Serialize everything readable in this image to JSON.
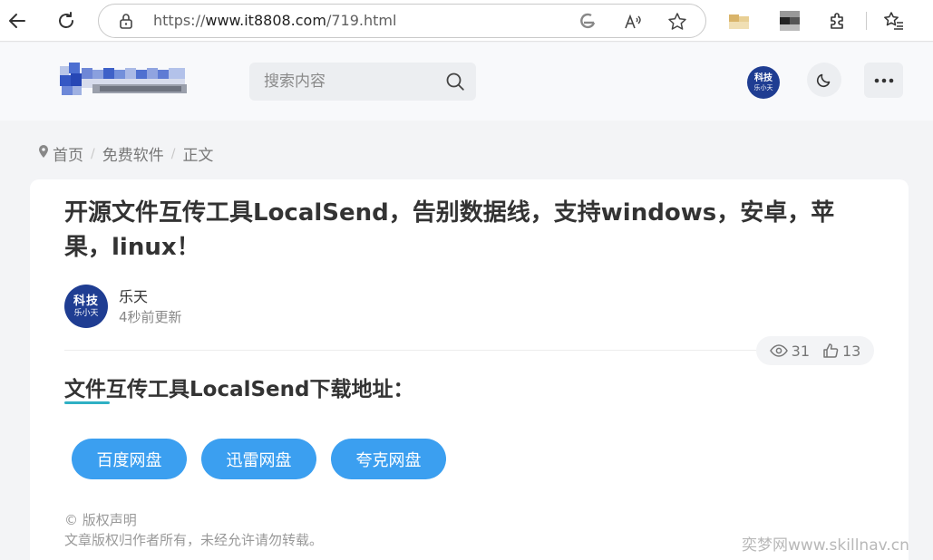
{
  "browser": {
    "url_prefix": "https://",
    "url_host": "www.it8808.com",
    "url_path": "/719.html"
  },
  "header": {
    "search_placeholder": "搜索内容",
    "avatar_line1": "科技",
    "avatar_line2": "乐小天"
  },
  "breadcrumb": {
    "items": [
      "首页",
      "免费软件",
      "正文"
    ],
    "separator": "/"
  },
  "article": {
    "title": "开源文件互传工具LocalSend，告别数据线，支持windows，安卓，苹果，linux！",
    "author": {
      "avatar_line1": "科技",
      "avatar_line2": "乐小天",
      "name": "乐天",
      "updated": "4秒前更新"
    },
    "stats": {
      "views": "31",
      "likes": "13"
    },
    "section_heading": "文件互传工具LocalSend下载地址：",
    "download_buttons": [
      "百度网盘",
      "迅雷网盘",
      "夸克网盘"
    ],
    "copyright_title": "© 版权声明",
    "copyright_text": "文章版权归作者所有，未经允许请勿转载。"
  },
  "watermark": "奕梦网www.skillnav.cn",
  "colors": {
    "accent_blue": "#3b9ff0",
    "avatar_navy": "#1f3d92",
    "heading_underline": "#2fb0c4"
  }
}
